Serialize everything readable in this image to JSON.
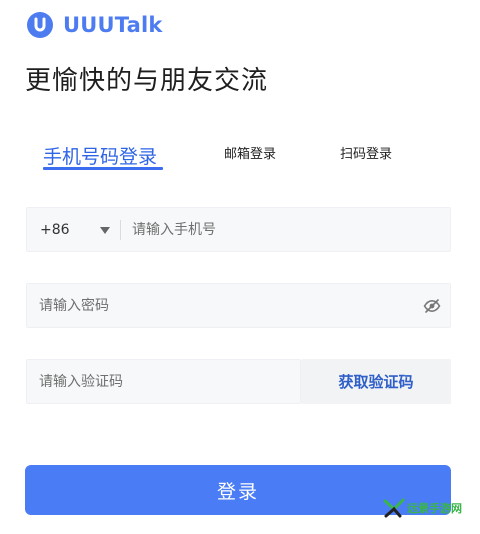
{
  "brand": {
    "name": "UUUTalk",
    "accent": "#4d7cf0"
  },
  "headline": "更愉快的与朋友交流",
  "tabs": [
    {
      "label": "手机号码登录",
      "active": true
    },
    {
      "label": "邮箱登录",
      "active": false
    },
    {
      "label": "扫码登录",
      "active": false
    }
  ],
  "phone": {
    "country_code": "+86",
    "placeholder": "请输入手机号"
  },
  "password": {
    "placeholder": "请输入密码",
    "toggle_icon": "eye-off-icon"
  },
  "code": {
    "placeholder": "请输入验证码",
    "get_code_label": "获取验证码"
  },
  "login_label": "登录",
  "watermark": {
    "text": "远景手游网",
    "color": "#39b54a"
  },
  "colors": {
    "primary_button": "#4a7cf6",
    "active_tab": "#2f64e6",
    "get_code": "#2f5fc8"
  }
}
